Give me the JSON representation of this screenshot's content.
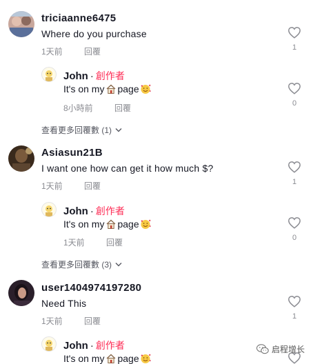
{
  "comments": [
    {
      "username": "triciaanne6475",
      "text": "Where do you purchase",
      "time": "1天前",
      "reply_label": "回覆",
      "likes": "1",
      "reply": {
        "username": "John",
        "creator_label": "創作者",
        "text_before": "It's on my",
        "text_after": "page",
        "house_icon": "house-emoji",
        "face_icon": "smiling-face-with-hearts-emoji",
        "time": "8小時前",
        "reply_label": "回覆",
        "likes": "0"
      },
      "more_label": "查看更多回覆數 (1)"
    },
    {
      "username": "Asiasun21B",
      "text": "I want one how can get it how much $?",
      "time": "1天前",
      "reply_label": "回覆",
      "likes": "1",
      "reply": {
        "username": "John",
        "creator_label": "創作者",
        "text_before": "It's on my",
        "text_after": "page",
        "house_icon": "house-emoji",
        "face_icon": "smiling-face-with-hearts-emoji",
        "time": "1天前",
        "reply_label": "回覆",
        "likes": "0"
      },
      "more_label": "查看更多回覆數 (3)"
    },
    {
      "username": "user1404974197280",
      "text": "Need This",
      "time": "1天前",
      "reply_label": "回覆",
      "likes": "1",
      "reply": {
        "username": "John",
        "creator_label": "創作者",
        "text_before": "It's on my",
        "text_after": "page",
        "house_icon": "house-emoji",
        "face_icon": "smiling-face-with-hearts-emoji"
      }
    }
  ],
  "watermark": {
    "text": "启程增长",
    "icon": "wechat-icon"
  },
  "colors": {
    "creator": "#fe2c55",
    "meta": "#8a8b91",
    "text": "#161823"
  }
}
